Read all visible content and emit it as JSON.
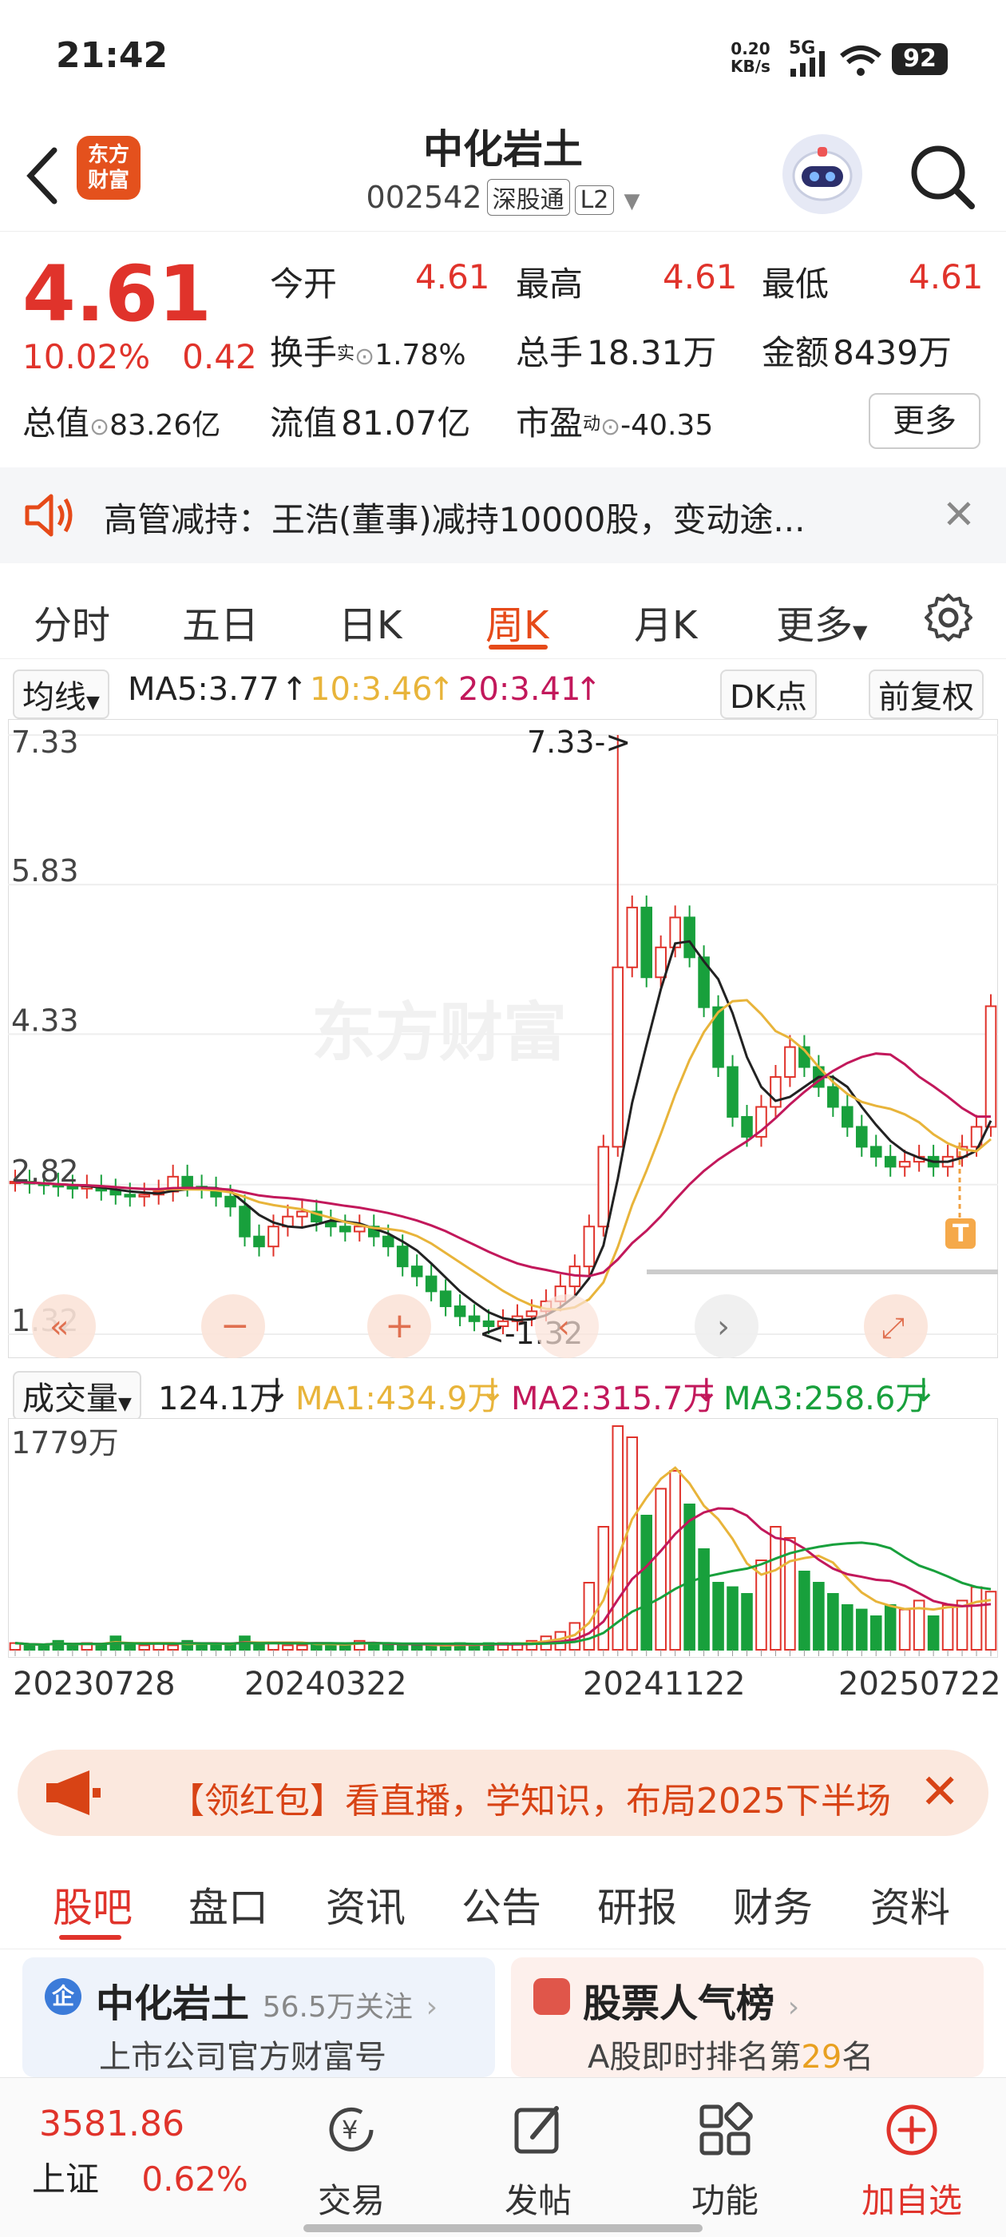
{
  "status": {
    "time": "21:42",
    "net_speed": "0.20",
    "net_unit": "KB/s",
    "signal": "5G",
    "battery": "92"
  },
  "header": {
    "logo_line1": "东方",
    "logo_line2": "财富",
    "title": "中化岩土",
    "code": "002542",
    "tag_market": "深股通",
    "tag_level": "L2"
  },
  "quote": {
    "price": "4.61",
    "change_pct": "10.02%",
    "change_amt": "0.42",
    "open_label": "今开",
    "open": "4.61",
    "high_label": "最高",
    "high": "4.61",
    "low_label": "最低",
    "low": "4.61",
    "turnover_label": "换手",
    "turnover_sup": "实",
    "turnover": "1.78%",
    "volume_label": "总手",
    "volume": "18.31万",
    "amount_label": "金额",
    "amount": "8439万",
    "mcap_label": "总值",
    "mcap": "83.26亿",
    "float_label": "流值",
    "float": "81.07亿",
    "pe_label": "市盈",
    "pe_sup": "动",
    "pe": "-40.35",
    "more": "更多"
  },
  "notice": {
    "text": "高管减持：王浩(董事)减持10000股，变动途..."
  },
  "ktabs": [
    "分时",
    "五日",
    "日K",
    "周K",
    "月K",
    "更多"
  ],
  "ma": {
    "selector": "均线",
    "ma5": "MA5:3.77",
    "ma10": "10:3.46",
    "ma20": "20:3.41",
    "dk": "DK点",
    "adjust": "前复权"
  },
  "chart_data": {
    "type": "candlestick",
    "y_ticks": [
      "7.33",
      "5.83",
      "4.33",
      "2.82",
      "1.32"
    ],
    "ylim": [
      1.32,
      7.33
    ],
    "max_label": "7.33->",
    "min_label": "<-1.32",
    "x_ticks": [
      "20230728",
      "20240322",
      "20241122",
      "20250722"
    ],
    "close_series": [
      2.85,
      2.83,
      2.82,
      2.8,
      2.78,
      2.8,
      2.76,
      2.72,
      2.7,
      2.72,
      2.75,
      2.9,
      2.8,
      2.78,
      2.7,
      2.6,
      2.3,
      2.2,
      2.4,
      2.5,
      2.55,
      2.45,
      2.4,
      2.35,
      2.4,
      2.3,
      2.2,
      2.0,
      1.9,
      1.75,
      1.6,
      1.5,
      1.45,
      1.4,
      1.45,
      1.5,
      1.55,
      1.65,
      1.8,
      2.0,
      2.4,
      3.2,
      5.0,
      5.6,
      4.9,
      5.2,
      5.5,
      5.1,
      4.6,
      4.0,
      3.5,
      3.3,
      3.6,
      3.9,
      4.2,
      4.0,
      3.8,
      3.6,
      3.4,
      3.2,
      3.1,
      3.0,
      3.05,
      3.1,
      3.0,
      3.1,
      3.2,
      3.4,
      4.61
    ],
    "ma_legend": [
      "MA5",
      "MA10",
      "MA20"
    ],
    "volume": {
      "selector": "成交量",
      "current": "124.1万",
      "ma1": "MA1:434.9万",
      "ma2": "MA2:315.7万",
      "ma3": "MA3:258.6万",
      "max_label": "1779万",
      "values": [
        3,
        2,
        2,
        4,
        2,
        3,
        2,
        6,
        2,
        2,
        3,
        2,
        4,
        3,
        2,
        2,
        6,
        3,
        3,
        2,
        2,
        3,
        3,
        2,
        4,
        3,
        2,
        2,
        2,
        2,
        2,
        3,
        2,
        3,
        3,
        3,
        4,
        6,
        8,
        12,
        30,
        55,
        100,
        95,
        60,
        72,
        80,
        65,
        45,
        30,
        28,
        25,
        40,
        55,
        50,
        35,
        30,
        25,
        20,
        18,
        15,
        20,
        18,
        22,
        15,
        20,
        22,
        28,
        26
      ]
    }
  },
  "promo": {
    "text": "【领红包】看直播，学知识，布局2025下半场"
  },
  "btabs": [
    "股吧",
    "盘口",
    "资讯",
    "公告",
    "研报",
    "财务",
    "资料"
  ],
  "cards": [
    {
      "title": "中化岩土",
      "sub": "56.5万关注",
      "desc": "上市公司官方财富号"
    },
    {
      "title": "股票人气榜",
      "desc_prefix": "A股即时排名第",
      "rank": "29",
      "desc_suffix": "名"
    }
  ],
  "bottomnav": {
    "index_value": "3581.86",
    "index_name": "上证",
    "index_pct": "0.62%",
    "trade": "交易",
    "post": "发帖",
    "func": "功能",
    "add": "加自选"
  },
  "colors": {
    "up": "#e0332b",
    "down": "#18a03c",
    "ma5": "#222222",
    "ma10": "#e8b43a",
    "ma20": "#c2185b",
    "accent": "#e64a19"
  }
}
